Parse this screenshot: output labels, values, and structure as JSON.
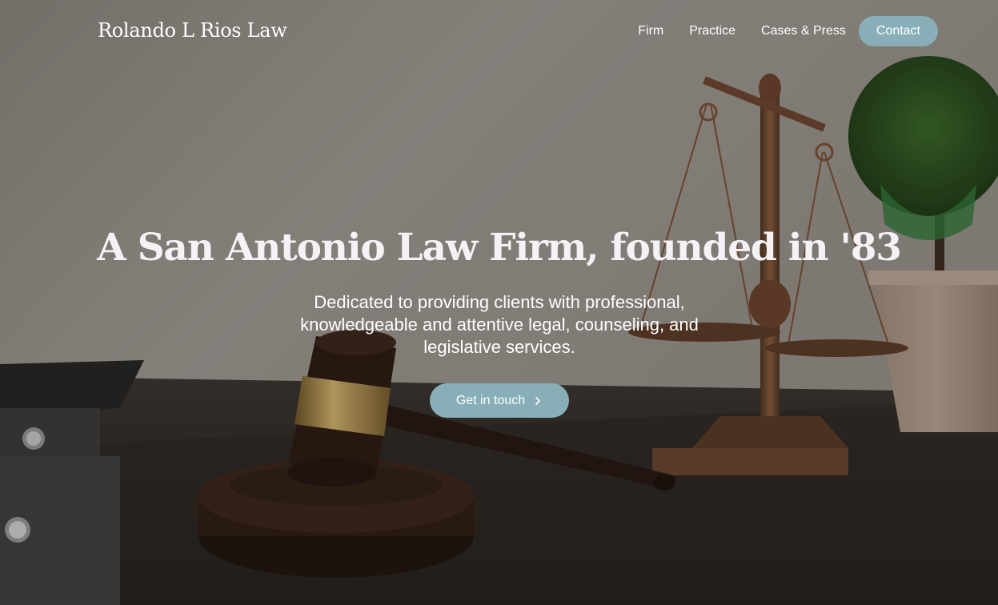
{
  "brand": {
    "name": "Rolando L Rios Law"
  },
  "nav": {
    "items": [
      {
        "label": "Firm"
      },
      {
        "label": "Practice"
      },
      {
        "label": "Cases & Press"
      }
    ],
    "contact_label": "Contact"
  },
  "hero": {
    "headline": "A San Antonio Law Firm, founded in '83",
    "subtext": "Dedicated to providing clients with professional, knowledgeable and attentive legal, counseling, and legislative services.",
    "cta_label": "Get in touch",
    "cta_icon": "chevron-right-icon",
    "background_image": "gavel-and-scales-of-justice-photo"
  },
  "colors": {
    "accent": "#88afb8",
    "text": "#ffffff"
  }
}
